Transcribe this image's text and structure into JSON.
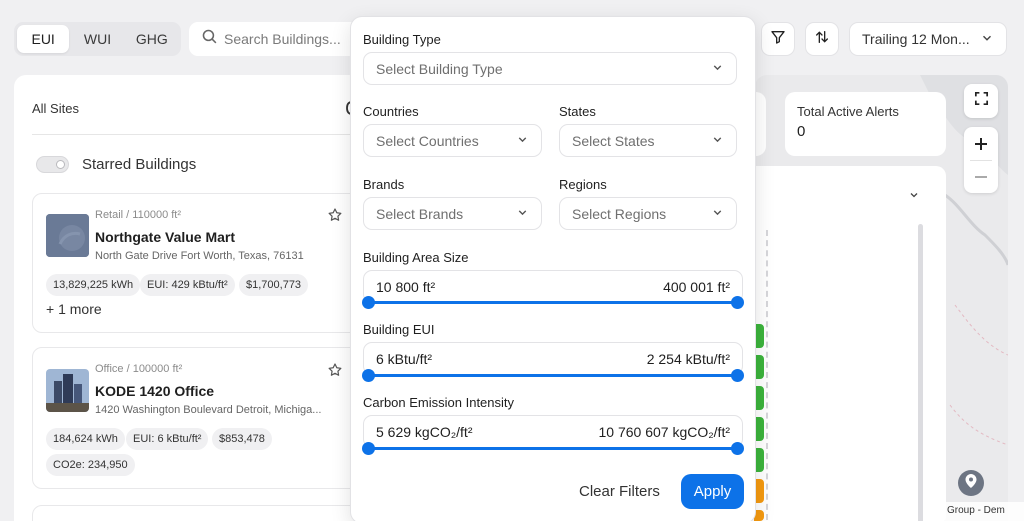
{
  "metric_toggle": {
    "options": [
      "EUI",
      "WUI",
      "GHG"
    ],
    "active": "EUI"
  },
  "search": {
    "placeholder": "Search Buildings..."
  },
  "period": {
    "label": "Trailing 12 Mon..."
  },
  "left_panel": {
    "all_sites": "All Sites",
    "starred_label": "Starred Buildings",
    "cards": [
      {
        "type": "Retail / 110000 ft²",
        "name": "Northgate Value Mart",
        "address": "North Gate Drive Fort Worth, Texas, 76131",
        "chips": [
          "13,829,225 kWh",
          "EUI: 429 kBtu/ft²",
          "$1,700,773"
        ],
        "more": "+ 1 more"
      },
      {
        "type": "Office / 100000 ft²",
        "name": "KODE 1420 Office",
        "address": "1420 Washington Boulevard Detroit, Michiga...",
        "chips": [
          "184,624 kWh",
          "EUI: 6 kBtu/ft²",
          "$853,478"
        ],
        "chips2": [
          "CO2e: 234,950"
        ]
      }
    ]
  },
  "alerts": {
    "title": "Total Active Alerts",
    "value": "0"
  },
  "map": {
    "attribution": "Group - Dem"
  },
  "filters": {
    "building_type": {
      "label": "Building Type",
      "placeholder": "Select Building Type"
    },
    "countries": {
      "label": "Countries",
      "placeholder": "Select Countries"
    },
    "states": {
      "label": "States",
      "placeholder": "Select States"
    },
    "brands": {
      "label": "Brands",
      "placeholder": "Select Brands"
    },
    "regions": {
      "label": "Regions",
      "placeholder": "Select Regions"
    },
    "area": {
      "label": "Building Area Size",
      "min": "10 800 ft²",
      "max": "400 001 ft²"
    },
    "eui": {
      "label": "Building EUI",
      "min": "6 kBtu/ft²",
      "max": "2 254 kBtu/ft²"
    },
    "carbon": {
      "label": "Carbon Emission Intensity",
      "min": "5 629 kgCO₂/ft²",
      "max": "10 760 607 kgCO₂/ft²"
    },
    "clear_label": "Clear Filters",
    "apply_label": "Apply"
  },
  "colors": {
    "accent": "#0d72e8",
    "bar_green": "#3cb43c",
    "bar_orange": "#f59a10"
  }
}
